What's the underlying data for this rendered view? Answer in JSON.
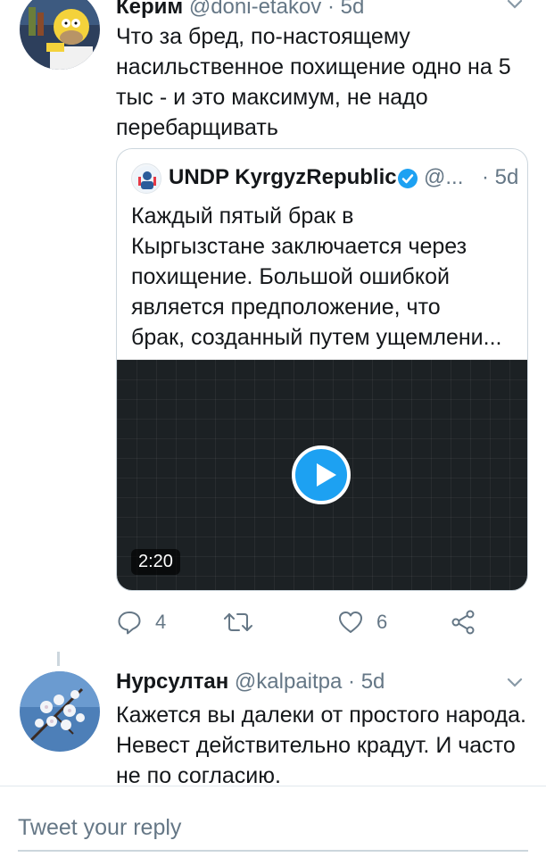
{
  "tweet1": {
    "name": "Керим",
    "handle": "@doni-etakov",
    "time": "· 5d",
    "avatar_icon": "homer-avatar-icon",
    "text": "Что за бред, по-настоящему насильственное похищение одно на 5 тыс - и это максимум, не надо перебарщивать",
    "quote": {
      "name": "UNDP KyrgyzRepublic",
      "verified_icon": "verified-badge-icon",
      "handle": "@...",
      "time": "· 5d",
      "text_lines": [
        "Каждый пятый брак в",
        "Кыргызстане заключается через",
        "похищение. Большой ошибкой",
        "является предположение, что",
        "брак, созданный путем ущемлени..."
      ],
      "video": {
        "play_icon": "play-icon",
        "duration": "2:20"
      }
    },
    "actions": {
      "reply_count": "4",
      "retweet_count": "",
      "like_count": "6",
      "icons": [
        "reply-icon",
        "retweet-icon",
        "like-icon",
        "share-icon"
      ]
    }
  },
  "tweet2": {
    "name": "Нурсултан",
    "handle": "@kalpaitpa",
    "time": "· 5d",
    "avatar_icon": "cherry-blossom-avatar-icon",
    "text": "Кажется вы далеки от простого народа. Невест действительно крадут. И часто не по согласию."
  },
  "reply": {
    "placeholder": "Tweet your reply"
  },
  "colors": {
    "accent": "#1da1f2",
    "text": "#14171a",
    "muted": "#657786",
    "border": "#ccd6dd"
  }
}
